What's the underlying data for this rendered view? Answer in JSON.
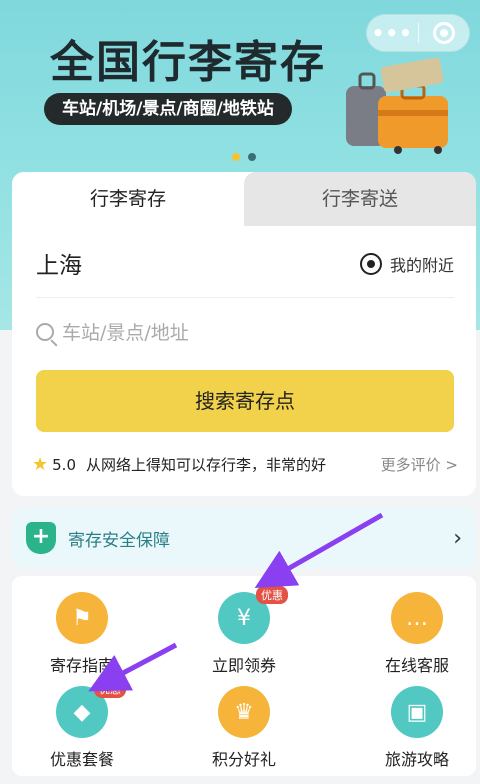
{
  "banner": {
    "title": "全国行李寄存",
    "subtitle": "车站/机场/景点/商圈/地铁站",
    "capsule_menu": "•••"
  },
  "tabs": [
    {
      "label": "行李寄存",
      "active": true
    },
    {
      "label": "行李寄送",
      "active": false
    }
  ],
  "location": {
    "city": "上海",
    "nearby_label": "我的附近"
  },
  "search": {
    "placeholder": "车站/景点/地址",
    "button_label": "搜索寄存点"
  },
  "review": {
    "rating": "5.0",
    "text": "从网络上得知可以存行李，非常的好",
    "more_label": "更多评价 >"
  },
  "safety": {
    "label": "寄存安全保障",
    "arrow": "›"
  },
  "services": [
    {
      "label": "寄存指南",
      "icon": "signpost-icon",
      "color": "#f6b43b",
      "badge": ""
    },
    {
      "label": "立即领券",
      "icon": "coupon-icon",
      "color": "#52c8c3",
      "badge": "优惠"
    },
    {
      "label": "在线客服",
      "icon": "chat-icon",
      "color": "#f6b43b",
      "badge": ""
    },
    {
      "label": "优惠套餐",
      "icon": "tag-icon",
      "color": "#52c8c3",
      "badge": "优惠"
    },
    {
      "label": "积分好礼",
      "icon": "crown-icon",
      "color": "#f6b43b",
      "badge": ""
    },
    {
      "label": "旅游攻略",
      "icon": "guidebook-icon",
      "color": "#52c8c3",
      "badge": ""
    }
  ],
  "colors": {
    "accent_yellow": "#f2d24a",
    "banner_teal": "#8fe0e2",
    "arrow_purple": "#8a3ff0"
  }
}
